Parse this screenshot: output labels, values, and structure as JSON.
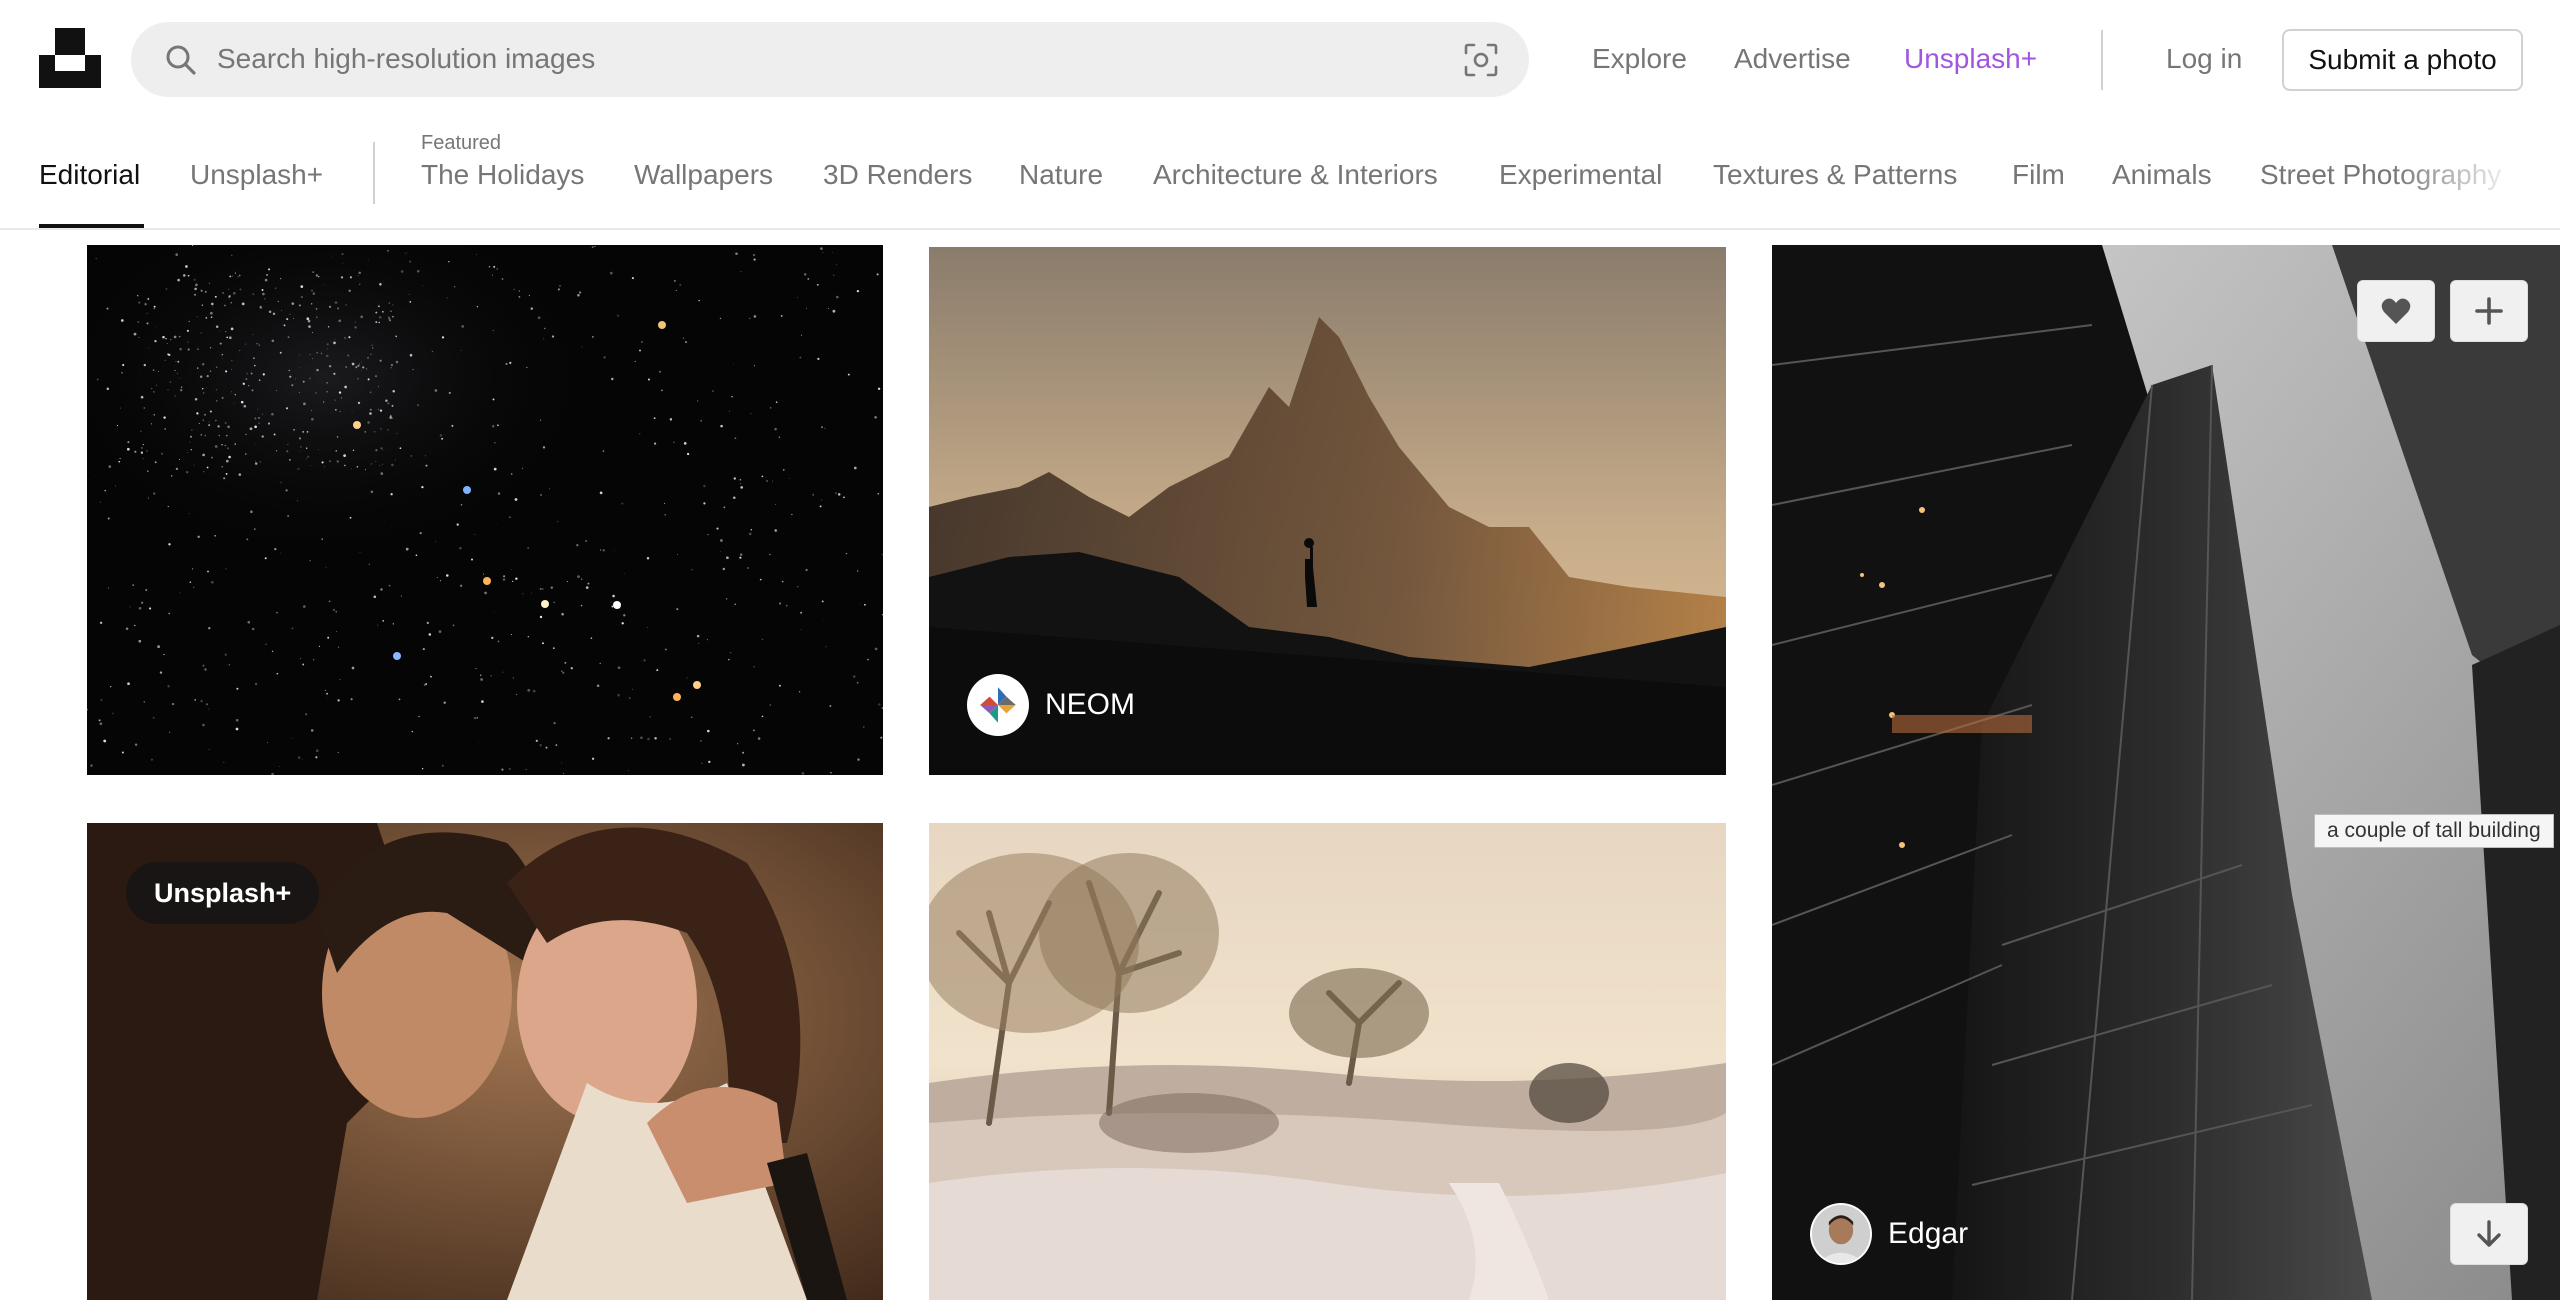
{
  "header": {
    "search": {
      "placeholder": "Search high-resolution images"
    },
    "nav": {
      "explore": "Explore",
      "advertise": "Advertise",
      "unsplash_plus": "Unsplash+",
      "login": "Log in",
      "submit": "Submit a photo"
    },
    "colors": {
      "accent": "#a155e0"
    }
  },
  "categories": {
    "primary": [
      {
        "label": "Editorial",
        "active": true
      },
      {
        "label": "Unsplash+",
        "active": false
      }
    ],
    "featured_label": "Featured",
    "featured": [
      {
        "label": "The Holidays"
      },
      {
        "label": "Wallpapers"
      },
      {
        "label": "3D Renders"
      },
      {
        "label": "Nature"
      },
      {
        "label": "Architecture & Interiors"
      },
      {
        "label": "Experimental"
      },
      {
        "label": "Textures & Patterns"
      },
      {
        "label": "Film"
      },
      {
        "label": "Animals"
      },
      {
        "label": "Street Photography"
      }
    ]
  },
  "photos": {
    "mountain": {
      "author": "NEOM"
    },
    "couple": {
      "badge": "Unsplash+"
    },
    "building": {
      "author": "Edgar",
      "tooltip": "a couple of tall building",
      "icons": [
        "heart-icon",
        "plus-icon",
        "download-arrow-icon"
      ]
    }
  }
}
